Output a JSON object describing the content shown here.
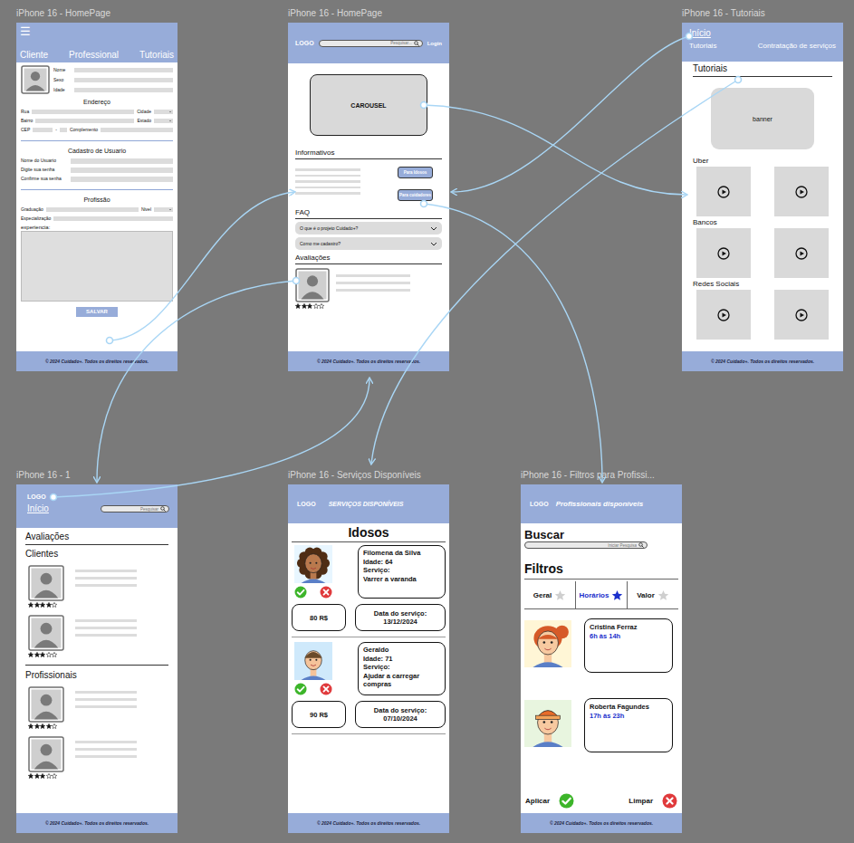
{
  "footer": "© 2024 Cuidado+. Todos os direitos reservados.",
  "cadastro": {
    "label": "iPhone 16 - HomePage",
    "menu_icon": "☰",
    "nav": [
      "Cliente",
      "Professional",
      "Tutoriais"
    ],
    "personal_fields": [
      "Nome",
      "Sexo",
      "Idade"
    ],
    "address": {
      "title": "Endereço",
      "rows": [
        [
          {
            "label": "Rua",
            "kind": "text"
          },
          {
            "label": "Cidade",
            "kind": "select"
          }
        ],
        [
          {
            "label": "Bairro",
            "kind": "text"
          },
          {
            "label": "Estado",
            "kind": "select"
          }
        ],
        [
          {
            "label": "CEP",
            "kind": "cep",
            "separator": "-"
          },
          {
            "label": "Complemento",
            "kind": "text"
          }
        ]
      ]
    },
    "user": {
      "title": "Cadastro de Usuario",
      "fields": [
        "Nome do Usuario",
        "Digite sua senha",
        "Confirme sua senha"
      ]
    },
    "profession": {
      "title": "Profissão",
      "rows": [
        [
          {
            "label": "Graduação",
            "kind": "text"
          },
          {
            "label": "Nivel",
            "kind": "select"
          }
        ],
        [
          {
            "label": "Especialização",
            "kind": "text"
          }
        ]
      ],
      "experience_label": "experiencia:"
    },
    "save_button": "SALVAR"
  },
  "home": {
    "label": "iPhone 16 - HomePage",
    "logo": "LOGO",
    "search": {
      "placeholder": "Pesquisar..."
    },
    "login": "Login",
    "carousel": "CAROUSEL",
    "informativos": {
      "title": "Informativos",
      "buttons": [
        "Para Idosos",
        "Para cuidadores"
      ]
    },
    "faq": {
      "title": "FAQ",
      "items": [
        {
          "question": "O que é o projeto Cuidado+?",
          "expanded": false
        },
        {
          "question": "Como me cadastro?",
          "expanded": false
        }
      ]
    },
    "reviews": {
      "title": "Avaliações",
      "items": [
        {
          "stars": 3
        }
      ]
    }
  },
  "tutoriais": {
    "label": "iPhone 16 - Tutoriais",
    "home_link": "Início",
    "nav": [
      "Tutoriais",
      "Contratação de serviços"
    ],
    "title": "Tutoriais",
    "banner": "banner",
    "sections": [
      {
        "title": "Uber",
        "videos": 2
      },
      {
        "title": "Bancos",
        "videos": 2
      },
      {
        "title": "Redes Sociais",
        "videos": 2
      }
    ]
  },
  "avaliacoes": {
    "label": "iPhone 16 - 1",
    "logo": "LOGO",
    "home_link": "Início",
    "search": {
      "placeholder": "Pesquisar"
    },
    "title": "Avaliações",
    "groups": [
      {
        "title": "Clientes",
        "items": [
          {
            "stars": 4
          },
          {
            "stars": 3
          }
        ]
      },
      {
        "title": "Profissionais",
        "items": [
          {
            "stars": 4
          },
          {
            "stars": 3
          }
        ]
      }
    ]
  },
  "servicos": {
    "label": "iPhone 16 - Serviços Disponíveis",
    "logo": "LOGO",
    "header_title": "SERVIÇOS DISPONÍVEIS",
    "title": "Idosos",
    "requests": [
      {
        "name": "Filomena da Silva",
        "age": "Idade: 64",
        "service_label": "Serviço:",
        "service": "Varrer a varanda",
        "price": "80 R$",
        "date_label": "Data do serviço:",
        "date": "13/12/2024"
      },
      {
        "name": "Geraldo",
        "age": "Idade: 71",
        "service_label": "Serviço:",
        "service": "Ajudar a carregar compras",
        "price": "90 R$",
        "date_label": "Data do serviço:",
        "date": "07/10/2024"
      }
    ]
  },
  "filtros": {
    "label": "iPhone 16 - Filtros para Profissi...",
    "logo": "LOGO",
    "header_title": "Profissionais disponíveis",
    "search_title": "Buscar",
    "search": {
      "placeholder": "Iniciar Pesquisa"
    },
    "filters_title": "Filtros",
    "filters": [
      {
        "label": "Geral",
        "selected": false
      },
      {
        "label": "Horários",
        "selected": true
      },
      {
        "label": "Valor",
        "selected": false
      }
    ],
    "professionals": [
      {
        "name": "Cristina Ferraz",
        "hours": "6h às 14h"
      },
      {
        "name": "Roberta Fagundes",
        "hours": "17h às 23h"
      }
    ],
    "apply": "Aplicar",
    "clear": "Limpar"
  }
}
